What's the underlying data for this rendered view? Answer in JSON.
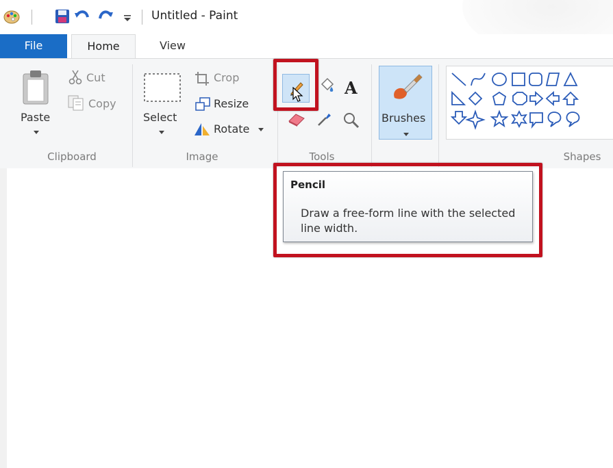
{
  "window": {
    "title": "Untitled - Paint"
  },
  "tabs": {
    "file": "File",
    "home": "Home",
    "view": "View"
  },
  "clipboard": {
    "paste": "Paste",
    "cut": "Cut",
    "copy": "Copy",
    "group": "Clipboard"
  },
  "image": {
    "select": "Select",
    "crop": "Crop",
    "resize": "Resize",
    "rotate": "Rotate",
    "group": "Image"
  },
  "tools": {
    "group": "Tools",
    "text_tool_glyph": "A"
  },
  "brushes": {
    "label": "Brushes"
  },
  "shapes": {
    "group": "Shapes"
  },
  "tooltip": {
    "title": "Pencil",
    "body": "Draw a free-form line with the selected line width."
  },
  "colors": {
    "file_tab": "#1a6dc6",
    "highlight": "#c1121f",
    "selected_tool": "#cfe4f7"
  }
}
